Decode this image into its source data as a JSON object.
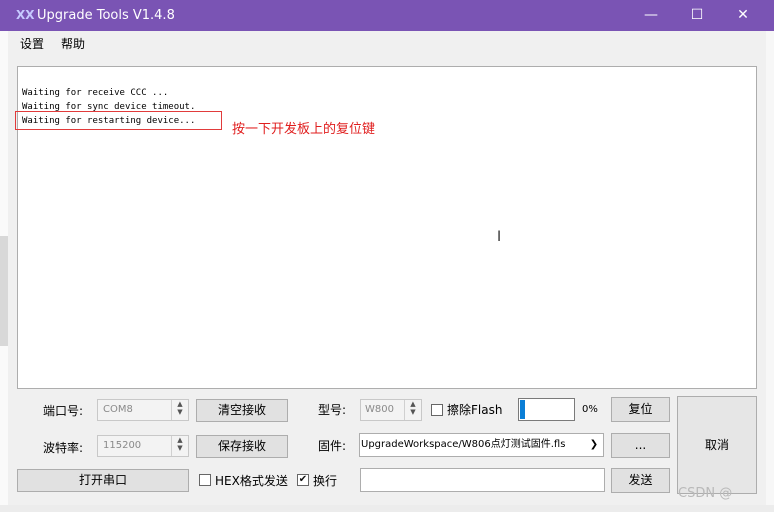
{
  "window": {
    "title": "Upgrade Tools V1.4.8",
    "app_icon": "app-icon",
    "minimize_glyph": "—",
    "maximize_glyph": "☐",
    "close_glyph": "✕",
    "titlebar_color": "#7a54b4"
  },
  "menu": {
    "settings": "设置",
    "help": "帮助"
  },
  "output": {
    "lines": [
      "Waiting for receive CCC ...",
      "Waiting for sync device timeout.",
      "Waiting for restarting device..."
    ],
    "annotation": "按一下开发板上的复位键",
    "annotation_color": "#e01e1e"
  },
  "serial": {
    "port_label": "端口号:",
    "port_value": "COM8",
    "baud_label": "波特率:",
    "baud_value": "115200",
    "open_button": "打开串口",
    "clear_button": "清空接收",
    "save_button": "保存接收",
    "hex_send_label": "HEX格式发送",
    "hex_send_checked": false,
    "newline_label": "换行",
    "newline_checked": true
  },
  "device": {
    "model_label": "型号:",
    "model_value": "W800",
    "erase_flash_label": "擦除Flash",
    "erase_flash_checked": false,
    "progress_percent": 0,
    "progress_text": "0%",
    "reset_button": "复位",
    "firmware_label": "固件:",
    "firmware_value": "UpgradeWorkspace/W806点灯测试固件.fls",
    "browse_button": "...",
    "send_value": "",
    "send_button": "发送",
    "cancel_button": "取消"
  },
  "watermark": "CSDN @"
}
